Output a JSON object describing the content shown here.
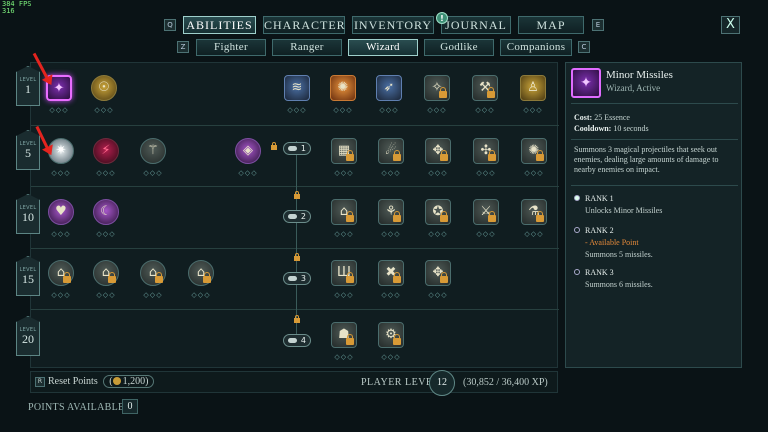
{
  "overlay": {
    "fps": "384 FPS",
    "fps_value": "316"
  },
  "main_tabs": {
    "key_left": "Q",
    "key_right": "E",
    "items": [
      {
        "label": "ABILITIES",
        "active": true
      },
      {
        "label": "CHARACTER",
        "active": false
      },
      {
        "label": "INVENTORY",
        "active": false
      },
      {
        "label": "JOURNAL",
        "active": false
      },
      {
        "label": "MAP",
        "active": false
      }
    ],
    "journal_alert": "!"
  },
  "close_label": "X",
  "sub_tabs": {
    "key_left": "Z",
    "key_right": "C",
    "items": [
      {
        "label": "Fighter",
        "active": false
      },
      {
        "label": "Ranger",
        "active": false
      },
      {
        "label": "Wizard",
        "active": true
      },
      {
        "label": "Godlike",
        "active": false
      },
      {
        "label": "Companions",
        "active": false
      }
    ]
  },
  "levels": [
    {
      "label": "LEVEL",
      "value": "1"
    },
    {
      "label": "LEVEL",
      "value": "5"
    },
    {
      "label": "LEVEL",
      "value": "10"
    },
    {
      "label": "LEVEL",
      "value": "15"
    },
    {
      "label": "LEVEL",
      "value": "20"
    }
  ],
  "tiers": [
    "1",
    "2",
    "3",
    "4"
  ],
  "pips": "◇◇◇",
  "bottom": {
    "reset_key": "R",
    "reset_label": "Reset Points",
    "reset_cost": "1,200",
    "player_level_label": "PLAYER LEVEL",
    "player_level": "12",
    "xp": "(30,852 / 36,400 XP)",
    "points_available_label": "POINTS AVAILABLE",
    "points_available": "0"
  },
  "detail": {
    "name": "Minor Missiles",
    "subtitle": "Wizard, Active",
    "cost_label": "Cost:",
    "cost_value": "25 Essence",
    "cooldown_label": "Cooldown:",
    "cooldown_value": "10 seconds",
    "description": "Summons 3 magical projectiles that seek out enemies, dealing large amounts of damage to nearby enemies on impact.",
    "ranks": [
      {
        "title": "RANK 1",
        "note": "",
        "body": "Unlocks Minor Missiles"
      },
      {
        "title": "RANK 2",
        "note": "- Available Point",
        "body": "Summons 5 missiles."
      },
      {
        "title": "RANK 3",
        "note": "",
        "body": "Summons 6 missiles."
      }
    ]
  }
}
